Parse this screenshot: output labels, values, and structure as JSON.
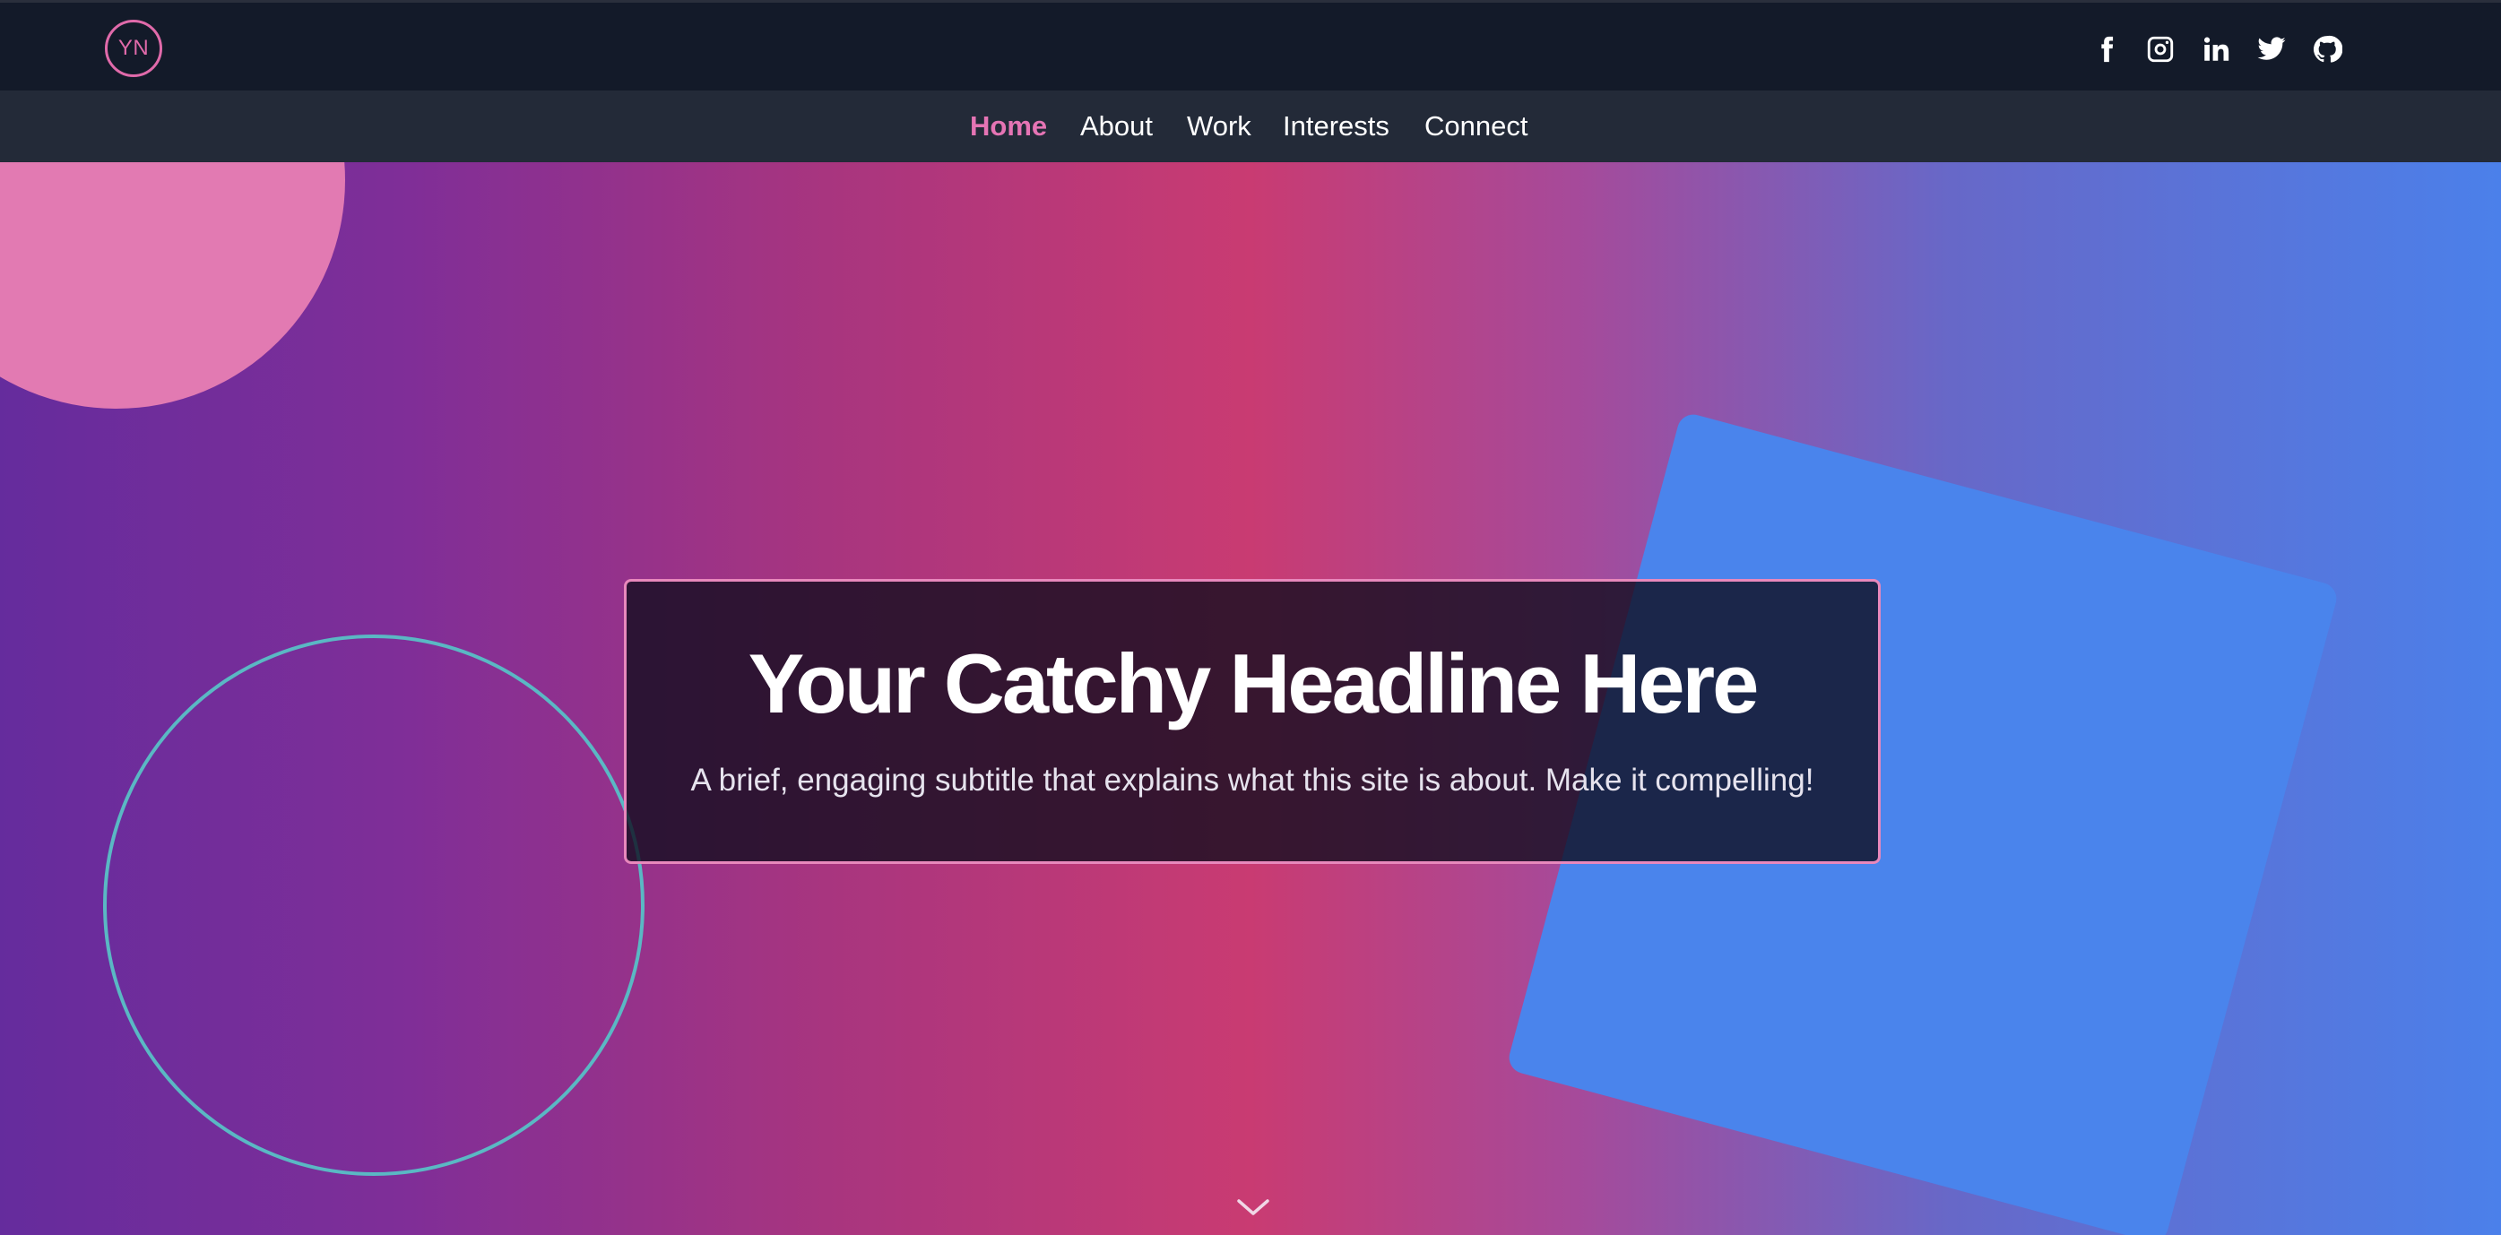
{
  "header": {
    "logo_text": "YN",
    "accent_color": "#e06aaa",
    "social_links": [
      {
        "name": "facebook",
        "icon": "facebook-icon"
      },
      {
        "name": "instagram",
        "icon": "instagram-icon"
      },
      {
        "name": "linkedin",
        "icon": "linkedin-icon"
      },
      {
        "name": "twitter",
        "icon": "twitter-icon"
      },
      {
        "name": "github",
        "icon": "github-icon"
      }
    ]
  },
  "nav": {
    "items": [
      {
        "label": "Home",
        "active": true
      },
      {
        "label": "About",
        "active": false
      },
      {
        "label": "Work",
        "active": false
      },
      {
        "label": "Interests",
        "active": false
      },
      {
        "label": "Connect",
        "active": false
      }
    ]
  },
  "hero": {
    "title": "Your Catchy Headline Here",
    "subtitle": "A brief, engaging subtitle that explains what this site is about. Make it compelling!",
    "scroll_icon": "chevron-down-icon",
    "colors": {
      "gradient_left": "#652c9d",
      "gradient_center": "#c93b72",
      "gradient_right": "#4b80ea",
      "pink_circle": "#e27ab2",
      "ring": "#5ab8c4",
      "blue_square": "#4a84ec",
      "card_border": "#e888bc"
    }
  }
}
